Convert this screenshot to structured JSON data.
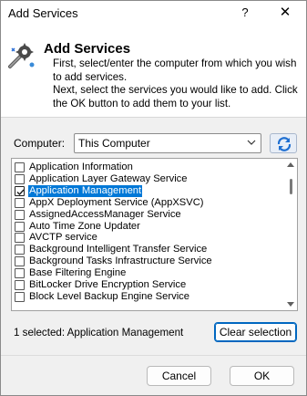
{
  "window": {
    "title": "Add Services",
    "help_label": "?",
    "close_label": "✕"
  },
  "header": {
    "heading": "Add Services",
    "line1": "First, select/enter the computer from which you wish to add services.",
    "line2": "Next, select the services you would like to add. Click the OK button to add them to your list."
  },
  "computer": {
    "label": "Computer:",
    "value": "This Computer"
  },
  "services": [
    {
      "label": "Application Information",
      "checked": false,
      "selected": false
    },
    {
      "label": "Application Layer Gateway Service",
      "checked": false,
      "selected": false
    },
    {
      "label": "Application Management",
      "checked": true,
      "selected": true
    },
    {
      "label": "AppX Deployment Service (AppXSVC)",
      "checked": false,
      "selected": false
    },
    {
      "label": "AssignedAccessManager Service",
      "checked": false,
      "selected": false
    },
    {
      "label": "Auto Time Zone Updater",
      "checked": false,
      "selected": false
    },
    {
      "label": "AVCTP service",
      "checked": false,
      "selected": false
    },
    {
      "label": "Background Intelligent Transfer Service",
      "checked": false,
      "selected": false
    },
    {
      "label": "Background Tasks Infrastructure Service",
      "checked": false,
      "selected": false
    },
    {
      "label": "Base Filtering Engine",
      "checked": false,
      "selected": false
    },
    {
      "label": "BitLocker Drive Encryption Service",
      "checked": false,
      "selected": false
    },
    {
      "label": "Block Level Backup Engine Service",
      "checked": false,
      "selected": false
    }
  ],
  "status": {
    "selected_text": "1 selected: Application Management"
  },
  "buttons": {
    "clear": "Clear selection",
    "cancel": "Cancel",
    "ok": "OK"
  },
  "colors": {
    "selection": "#0078d7",
    "refresh_icon": "#1f6fd1"
  }
}
